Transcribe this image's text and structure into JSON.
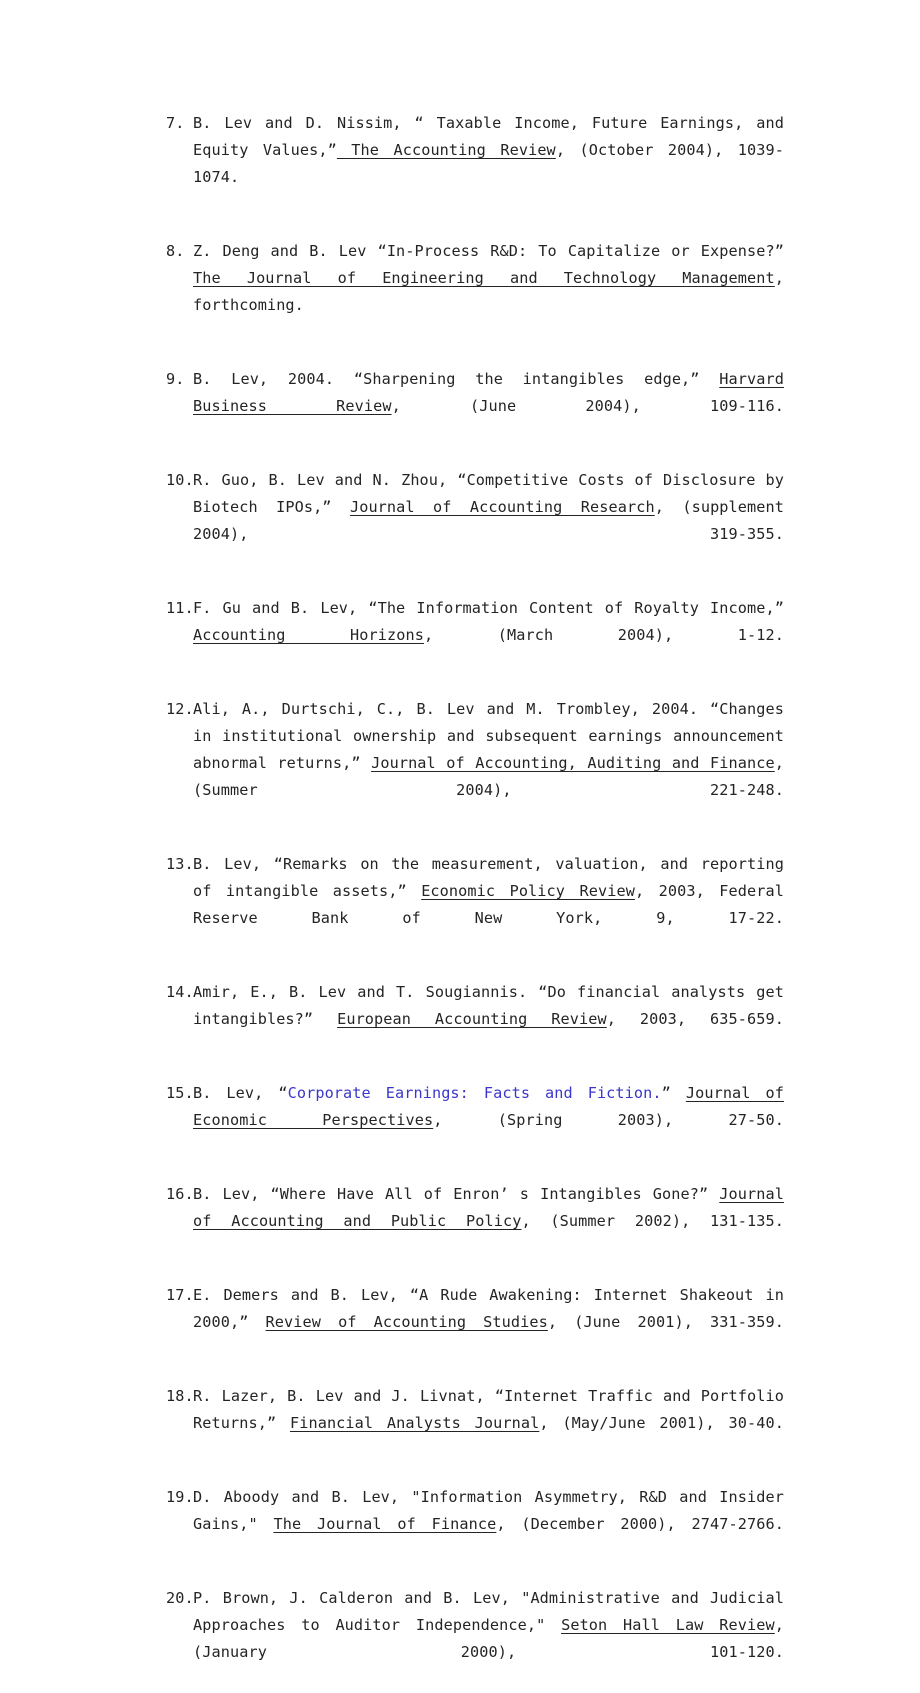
{
  "page": {
    "background_color": "#ffffff",
    "text_color": "#242424",
    "link_color": "#3a36cc"
  },
  "document": {
    "type": "publication-reference-list",
    "start_number": 7,
    "end_number": 20,
    "references": [
      {
        "number": "7.",
        "segments": [
          {
            "text": "B. Lev and D. Nissim,  “ Taxable Income, Future Earnings, and Equity Values,”",
            "style": "plain"
          },
          {
            "text": " The Accounting Review",
            "style": "underline"
          },
          {
            "text": ",  (October 2004),  1039-1074.",
            "style": "plain"
          }
        ]
      },
      {
        "number": "8.",
        "segments": [
          {
            "text": "Z. Deng and B. Lev “In-Process R&D: To Capitalize or Expense?” ",
            "style": "plain"
          },
          {
            "text": "The Journal of Engineering and Technology Management",
            "style": "underline"
          },
          {
            "text": ", forthcoming.",
            "style": "plain"
          }
        ]
      },
      {
        "number": "9.",
        "segments": [
          {
            "text": "B. Lev, 2004.  “Sharpening the intangibles edge,” ",
            "style": "plain"
          },
          {
            "text": "Harvard Business Review",
            "style": "underline"
          },
          {
            "text": ",  (June 2004), 109-116.",
            "style": "plain"
          }
        ]
      },
      {
        "number": "10.",
        "segments": [
          {
            "text": "R. Guo, B. Lev and N. Zhou,  “Competitive Costs of Disclosure by Biotech IPOs,” ",
            "style": "plain"
          },
          {
            "text": "Journal of Accounting Research",
            "style": "underline"
          },
          {
            "text": ", (supplement 2004), 319-355.",
            "style": "plain"
          }
        ]
      },
      {
        "number": "11.",
        "segments": [
          {
            "text": "F. Gu and B. Lev,  “The Information Content of Royalty Income,” ",
            "style": "plain"
          },
          {
            "text": "Accounting Horizons",
            "style": "underline"
          },
          {
            "text": ", (March 2004), 1-12.",
            "style": "plain"
          }
        ]
      },
      {
        "number": "12.",
        "segments": [
          {
            "text": "Ali, A., Durtschi, C., B. Lev and M. Trombley, 2004.  “Changes in institutional ownership and subsequent earnings announcement abnormal returns,” ",
            "style": "plain"
          },
          {
            "text": "Journal of Accounting, Auditing and Finance",
            "style": "underline"
          },
          {
            "text": ", (Summer 2004), 221-248.",
            "style": "plain"
          }
        ]
      },
      {
        "number": "13.",
        "segments": [
          {
            "text": "B. Lev,  “Remarks on the measurement, valuation, and reporting of intangible assets,” ",
            "style": "plain"
          },
          {
            "text": "Economic Policy Review",
            "style": "underline"
          },
          {
            "text": ", 2003, Federal Reserve Bank of New York, 9, 17-22.",
            "style": "plain"
          }
        ]
      },
      {
        "number": "14.",
        "segments": [
          {
            "text": "Amir, E., B. Lev and T. Sougiannis.  “Do financial analysts get intangibles?” ",
            "style": "plain"
          },
          {
            "text": "European Accounting Review",
            "style": "underline"
          },
          {
            "text": ", 2003, 635-659.",
            "style": "plain"
          }
        ]
      },
      {
        "number": "15.",
        "segments": [
          {
            "text": "B. Lev,  “",
            "style": "plain"
          },
          {
            "text": "Corporate Earnings: Facts and Fiction.",
            "style": "link"
          },
          {
            "text": "” ",
            "style": "plain"
          },
          {
            "text": "Journal of Economic Perspectives",
            "style": "underline"
          },
          {
            "text": ",  (Spring 2003), 27-50.",
            "style": "plain"
          }
        ]
      },
      {
        "number": "16.",
        "segments": [
          {
            "text": "B. Lev,  “Where Have All of Enron’ s Intangibles Gone?” ",
            "style": "plain"
          },
          {
            "text": "Journal of Accounting and Public Policy",
            "style": "underline"
          },
          {
            "text": ", (Summer 2002), 131-135.",
            "style": "plain"
          }
        ]
      },
      {
        "number": "17.",
        "segments": [
          {
            "text": "E. Demers and B. Lev,  “A Rude Awakening: Internet Shakeout in 2000,” ",
            "style": "plain"
          },
          {
            "text": "Review of Accounting Studies",
            "style": "underline"
          },
          {
            "text": ",  (June 2001), 331-359.",
            "style": "plain"
          }
        ]
      },
      {
        "number": "18.",
        "segments": [
          {
            "text": "R. Lazer, B. Lev and J. Livnat,  “Internet Traffic and Portfolio Returns,” ",
            "style": "plain"
          },
          {
            "text": "Financial Analysts Journal",
            "style": "underline"
          },
          {
            "text": ", (May/June 2001), 30-40.",
            "style": "plain"
          }
        ]
      },
      {
        "number": "19.",
        "segments": [
          {
            "text": "D. Aboody and B. Lev, \"Information Asymmetry, R&D and Insider Gains,\" ",
            "style": "plain"
          },
          {
            "text": "The Journal of Finance",
            "style": "underline"
          },
          {
            "text": ",  (December 2000),  2747-2766.",
            "style": "plain"
          }
        ]
      },
      {
        "number": "20.",
        "segments": [
          {
            "text": "P. Brown, J. Calderon and B. Lev, \"Administrative and Judicial Approaches to Auditor Independence,\" ",
            "style": "plain"
          },
          {
            "text": "Seton Hall Law Review",
            "style": "underline"
          },
          {
            "text": ", (January 2000), 101-120.",
            "style": "plain"
          }
        ]
      }
    ]
  }
}
